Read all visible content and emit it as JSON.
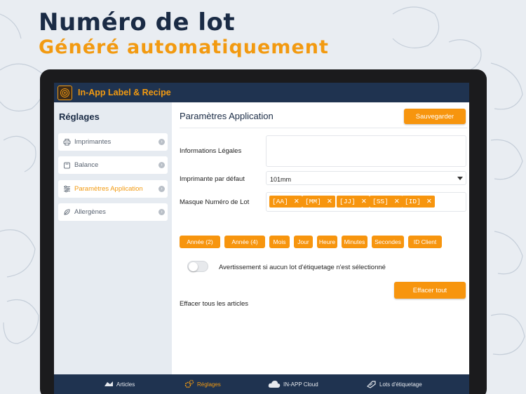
{
  "hero": {
    "title": "Numéro de lot",
    "subtitle": "Généré automatiquement"
  },
  "app": {
    "title": "In-App Label & Recipe"
  },
  "sidebar": {
    "title": "Réglages",
    "items": [
      {
        "label": "Imprimantes",
        "icon": "printer-icon",
        "active": false
      },
      {
        "label": "Balance",
        "icon": "scale-icon",
        "active": false
      },
      {
        "label": "Paramètres Application",
        "icon": "sliders-icon",
        "active": true
      },
      {
        "label": "Allergènes",
        "icon": "leaf-icon",
        "active": false
      }
    ]
  },
  "main": {
    "title": "Paramètres Application",
    "save_label": "Sauvegarder",
    "legal_label": "Informations Légales",
    "legal_value": "",
    "printer_label": "Imprimante par défaut",
    "printer_value": "101mm",
    "mask_label": "Masque Numéro de Lot",
    "mask_tags": [
      "[AA]",
      "[MM]",
      "[JJ]",
      "[SS]",
      "[ID]"
    ],
    "chips": [
      "Année (2)",
      "Année (4)",
      "Mois",
      "Jour",
      "Heure",
      "Minutes",
      "Secondes",
      "ID Client"
    ],
    "toggle_label": "Avertissement si aucun lot d'étiquetage n'est sélectionné",
    "toggle_on": false,
    "clear_label": "Effacer tous les articles",
    "clear_button": "Effacer tout"
  },
  "tabbar": {
    "items": [
      {
        "label": "Articles",
        "icon": "articles-icon",
        "active": false
      },
      {
        "label": "Réglages",
        "icon": "gears-icon",
        "active": true
      },
      {
        "label": "IN-APP Cloud",
        "icon": "cloud-icon",
        "active": false
      },
      {
        "label": "Lots d'étiquetage",
        "icon": "label-icon",
        "active": false
      }
    ]
  },
  "colors": {
    "accent": "#f7950e",
    "navy": "#1f3350",
    "sidebar_bg": "#e6ebf1"
  }
}
